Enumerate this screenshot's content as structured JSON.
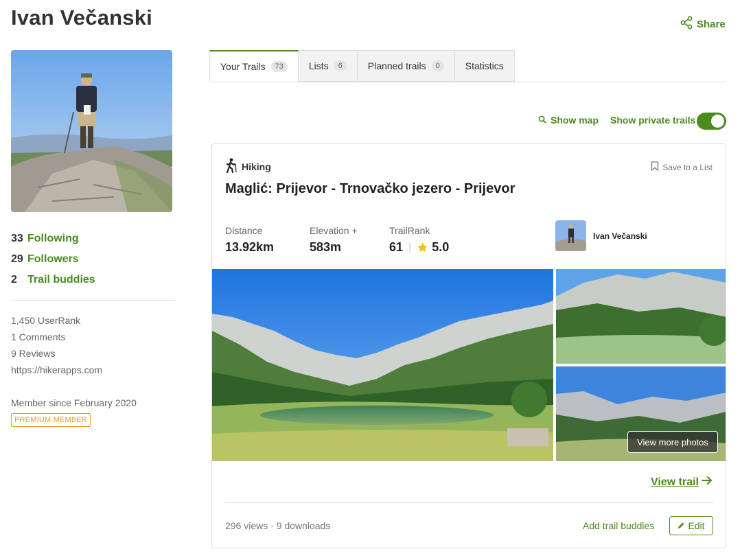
{
  "profile": {
    "name": "Ivan Večanski",
    "share_label": "Share"
  },
  "social": {
    "following_count": "33",
    "following_label": "Following",
    "followers_count": "29",
    "followers_label": "Followers",
    "buddies_count": "2",
    "buddies_label": "Trail buddies"
  },
  "stats": {
    "userrank": "1,450 UserRank",
    "comments": "1  Comments",
    "reviews": "9  Reviews",
    "website": "https://hikerapps.com",
    "member_since": "Member since  February 2020",
    "premium": "PREMIUM MEMBER"
  },
  "tabs": [
    {
      "label": "Your Trails",
      "count": "73"
    },
    {
      "label": "Lists",
      "count": "6"
    },
    {
      "label": "Planned trails",
      "count": "0"
    },
    {
      "label": "Statistics"
    }
  ],
  "filters": {
    "show_map": "Show map",
    "show_private": "Show private trails",
    "private_on": true
  },
  "trail": {
    "activity": "Hiking",
    "save_label": "Save to a List",
    "title": "Maglić: Prijevor - Trnovačko jezero - Prijevor",
    "distance_label": "Distance",
    "distance_value": "13.92km",
    "elevation_label": "Elevation +",
    "elevation_value": "583m",
    "trailrank_label": "TrailRank",
    "trailrank_value": "61",
    "rating_value": "5.0",
    "author": "Ivan Večanski",
    "view_more_photos": "View more photos",
    "view_trail": "View trail",
    "views_downloads": "296 views · 9 downloads",
    "add_buddies": "Add trail buddies",
    "edit_label": "Edit"
  },
  "colors": {
    "accent": "#4a8a1f",
    "premium": "#e6a020",
    "star": "#f2c200"
  }
}
